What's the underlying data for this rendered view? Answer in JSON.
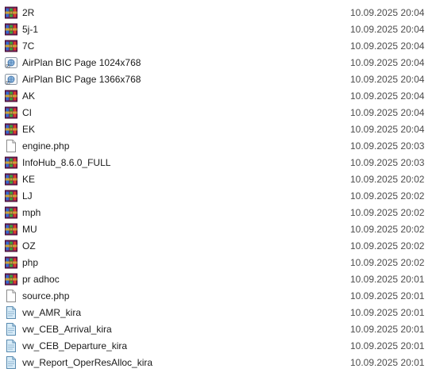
{
  "files": [
    {
      "name": "2R",
      "date": "10.09.2025 20:04",
      "icon": "winrar-archive-icon"
    },
    {
      "name": "5j-1",
      "date": "10.09.2025 20:04",
      "icon": "winrar-archive-icon"
    },
    {
      "name": "7C",
      "date": "10.09.2025 20:04",
      "icon": "winrar-archive-icon"
    },
    {
      "name": "AirPlan BIC Page 1024x768",
      "date": "10.09.2025 20:04",
      "icon": "web-shortcut-icon"
    },
    {
      "name": "AirPlan BIC Page 1366x768",
      "date": "10.09.2025 20:04",
      "icon": "web-shortcut-icon"
    },
    {
      "name": "AK",
      "date": "10.09.2025 20:04",
      "icon": "winrar-archive-icon"
    },
    {
      "name": "CI",
      "date": "10.09.2025 20:04",
      "icon": "winrar-archive-icon"
    },
    {
      "name": "EK",
      "date": "10.09.2025 20:04",
      "icon": "winrar-archive-icon"
    },
    {
      "name": "engine.php",
      "date": "10.09.2025 20:03",
      "icon": "blank-file-icon"
    },
    {
      "name": "InfoHub_8.6.0_FULL",
      "date": "10.09.2025 20:03",
      "icon": "winrar-archive-icon"
    },
    {
      "name": "KE",
      "date": "10.09.2025 20:02",
      "icon": "winrar-archive-icon"
    },
    {
      "name": "LJ",
      "date": "10.09.2025 20:02",
      "icon": "winrar-archive-icon"
    },
    {
      "name": "mph",
      "date": "10.09.2025 20:02",
      "icon": "winrar-archive-icon"
    },
    {
      "name": "MU",
      "date": "10.09.2025 20:02",
      "icon": "winrar-archive-icon"
    },
    {
      "name": "OZ",
      "date": "10.09.2025 20:02",
      "icon": "winrar-archive-icon"
    },
    {
      "name": "php",
      "date": "10.09.2025 20:02",
      "icon": "winrar-archive-icon"
    },
    {
      "name": "pr adhoc",
      "date": "10.09.2025 20:01",
      "icon": "winrar-archive-icon"
    },
    {
      "name": "source.php",
      "date": "10.09.2025 20:01",
      "icon": "blank-file-icon"
    },
    {
      "name": "vw_AMR_kira",
      "date": "10.09.2025 20:01",
      "icon": "sql-file-icon"
    },
    {
      "name": "vw_CEB_Arrival_kira",
      "date": "10.09.2025 20:01",
      "icon": "sql-file-icon"
    },
    {
      "name": "vw_CEB_Departure_kira",
      "date": "10.09.2025 20:01",
      "icon": "sql-file-icon"
    },
    {
      "name": "vw_Report_OperResAlloc_kira",
      "date": "10.09.2025 20:01",
      "icon": "sql-file-icon"
    }
  ]
}
